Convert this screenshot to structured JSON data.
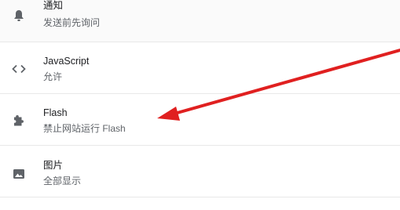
{
  "settings": {
    "items": [
      {
        "icon": "bell-icon",
        "title": "通知",
        "subtitle": "发送前先询问"
      },
      {
        "icon": "code-icon",
        "title": "JavaScript",
        "subtitle": "允许"
      },
      {
        "icon": "puzzle-icon",
        "title": "Flash",
        "subtitle": "禁止网站运行 Flash"
      },
      {
        "icon": "image-icon",
        "title": "图片",
        "subtitle": "全部显示"
      }
    ]
  },
  "annotation": {
    "arrow_color": "#e02020",
    "arrow_target": "Flash"
  },
  "colors": {
    "icon": "#5f6368",
    "title": "#202124",
    "subtitle": "#5f6368",
    "divider": "#e8e8e8"
  }
}
